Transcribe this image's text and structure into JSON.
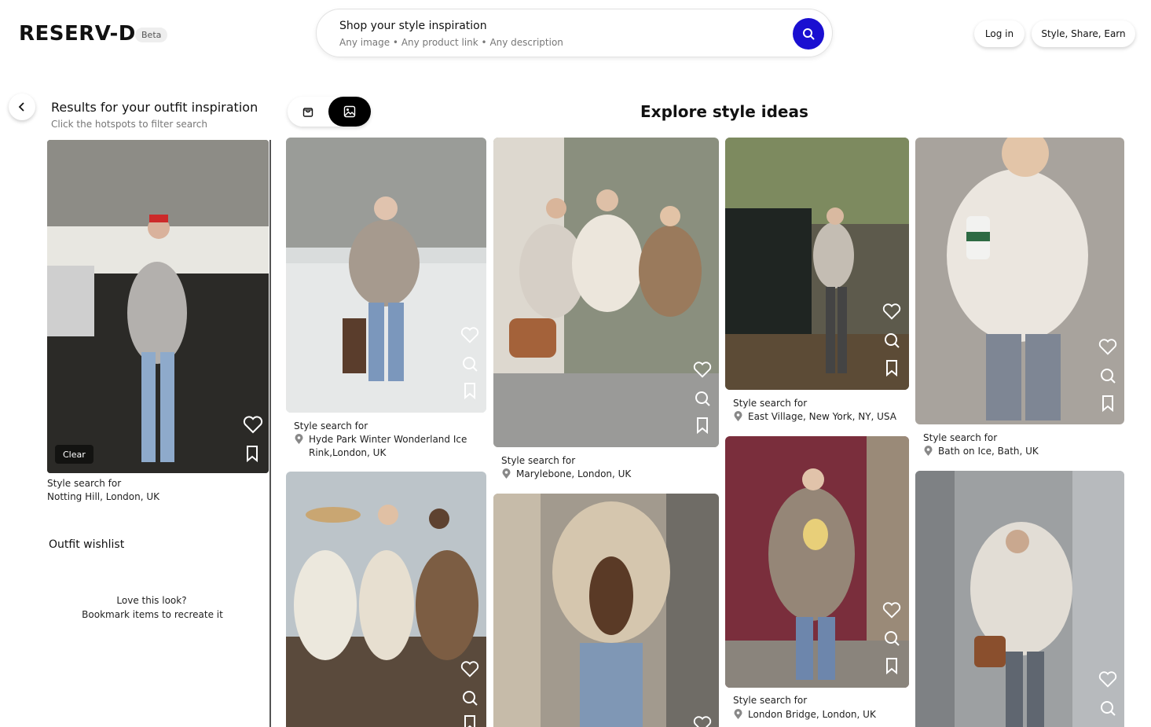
{
  "header": {
    "logo": "RESERV-D",
    "beta_label": "Beta",
    "search_title": "Shop your style inspiration",
    "search_hint": "Any image • Any product link •  Any description",
    "login_label": "Log in",
    "earn_label": "Style, Share, Earn"
  },
  "sidebar": {
    "results_title": "Results for your outfit inspiration",
    "results_subtitle": "Click the hotspots to filter search",
    "clear_label": "Clear",
    "inspiration": {
      "caption_prefix": "Style search for",
      "location": "Notting Hill, London, UK"
    },
    "wishlist_title": "Outfit wishlist",
    "wishlist_empty_line1": "Love this look?",
    "wishlist_empty_line2": "Bookmark items to recreate it"
  },
  "main": {
    "explore_title": "Explore style ideas",
    "caption_prefix": "Style search for",
    "cards": [
      {
        "location": "Hyde Park Winter Wonderland Ice Rink,London, UK"
      },
      {
        "location": "Marylebone, London, UK"
      },
      {
        "location": "East Village, New York, NY, USA"
      },
      {
        "location": "Bath on Ice, Bath, UK"
      },
      {
        "location": ""
      },
      {
        "location": ""
      },
      {
        "location": "London Bridge, London, UK"
      },
      {
        "location": ""
      }
    ]
  },
  "icons": {
    "search": "search-icon",
    "back": "chevron-left-icon",
    "products_view": "shopping-bag-icon",
    "images_view": "image-icon",
    "like": "heart-icon",
    "visual_search": "search-icon",
    "save": "bookmark-icon",
    "location": "location-pin-icon"
  },
  "colors": {
    "accent": "#1a0fd1",
    "toggle_active": "#000000"
  }
}
